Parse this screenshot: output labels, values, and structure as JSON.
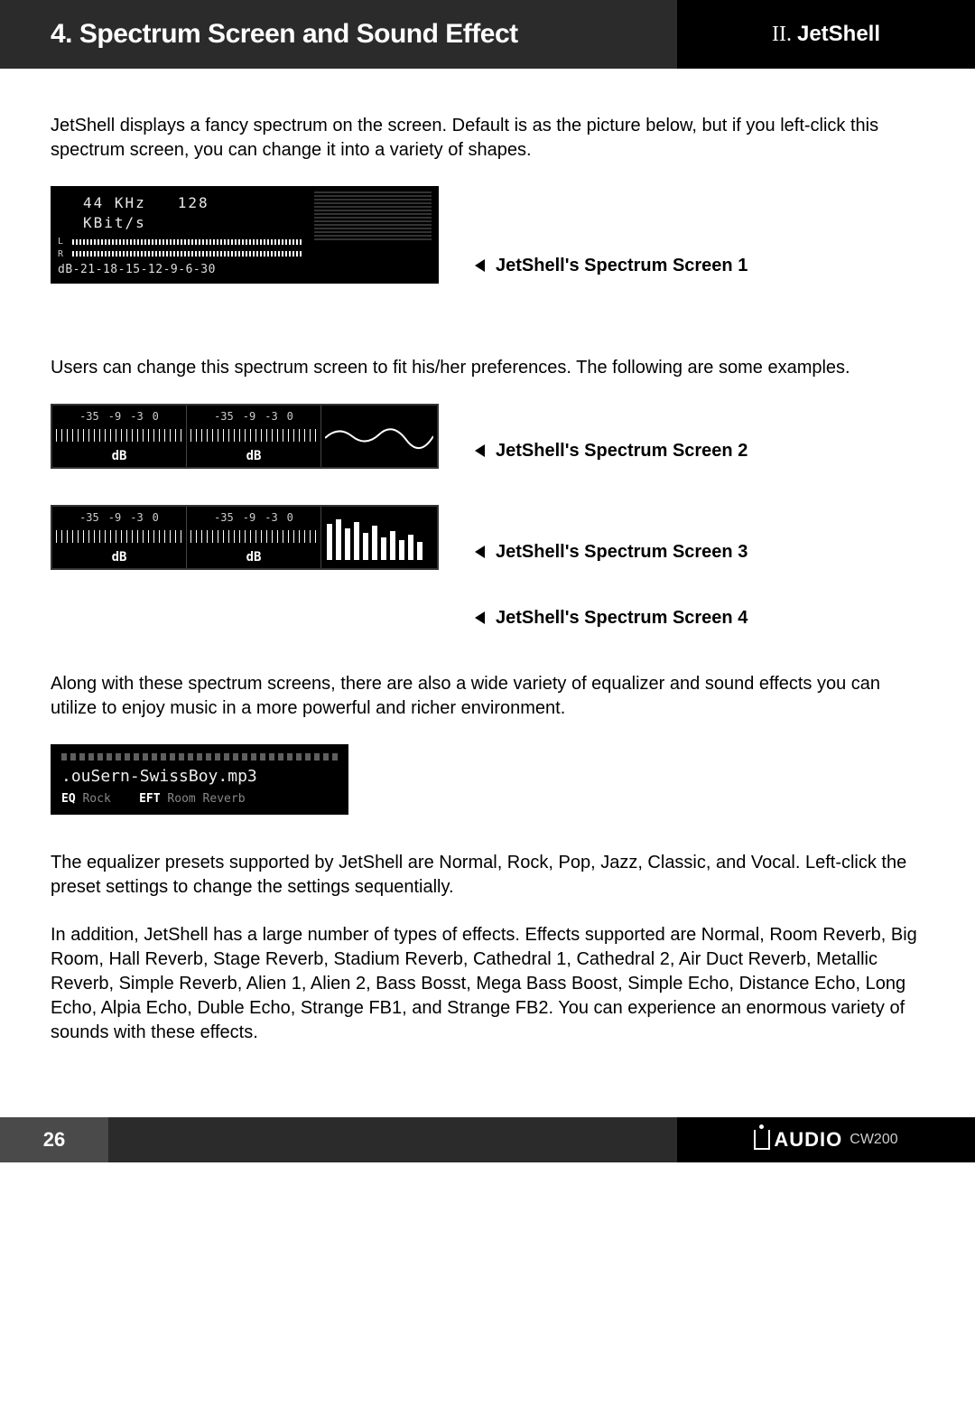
{
  "header": {
    "title": "4. Spectrum Screen and Sound Effect",
    "section_roman": "II.",
    "section_name": "JetShell"
  },
  "intro": "JetShell displays a fancy spectrum on the screen. Default is as the picture below, but if you left-click this spectrum screen, you can change it into a variety of shapes.",
  "fig1": {
    "khz": "44 KHz",
    "kbits": "128 KBit/s",
    "L": "L",
    "R": "R",
    "db_scale": [
      "dB",
      "-21",
      "-18",
      "-15",
      "-12",
      "-9",
      "-6",
      "-3",
      "0"
    ],
    "caption": "JetShell's Spectrum Screen 1"
  },
  "para2": "Users can change this spectrum screen to fit his/her preferences. The following are some examples.",
  "meter": {
    "scale": [
      "-35",
      "-9",
      "-3",
      "0"
    ],
    "db": "dB"
  },
  "fig2_caption": "JetShell's Spectrum Screen 2",
  "fig3_caption": "JetShell's Spectrum Screen 3",
  "fig4_caption": "JetShell's Spectrum Screen 4",
  "para3": "Along with these spectrum screens, there are also a wide variety of equalizer and sound effects you can utilize to enjoy music in a more powerful and richer environment.",
  "eq": {
    "file": ".ouSern-SwissBoy.mp3",
    "eq_label": "EQ",
    "eq_val": "Rock",
    "eft_label": "EFT",
    "eft_val": "Room Reverb"
  },
  "para4": "The equalizer presets supported by JetShell are Normal, Rock, Pop, Jazz, Classic, and Vocal. Left-click the preset settings to change the settings sequentially.",
  "para5": "In addition, JetShell has a large number of types of effects. Effects supported are Normal, Room Reverb, Big Room, Hall Reverb, Stage Reverb, Stadium Reverb, Cathedral 1, Cathedral 2, Air Duct Reverb, Metallic Reverb, Simple Reverb, Alien 1, Alien 2, Bass Bosst, Mega Bass Boost, Simple Echo, Distance Echo, Long Echo, Alpia Echo, Duble Echo, Strange FB1, and Strange FB2. You can experience an enormous variety of sounds with these effects.",
  "footer": {
    "page": "26",
    "brand": "AUDIO",
    "model": "CW200"
  }
}
